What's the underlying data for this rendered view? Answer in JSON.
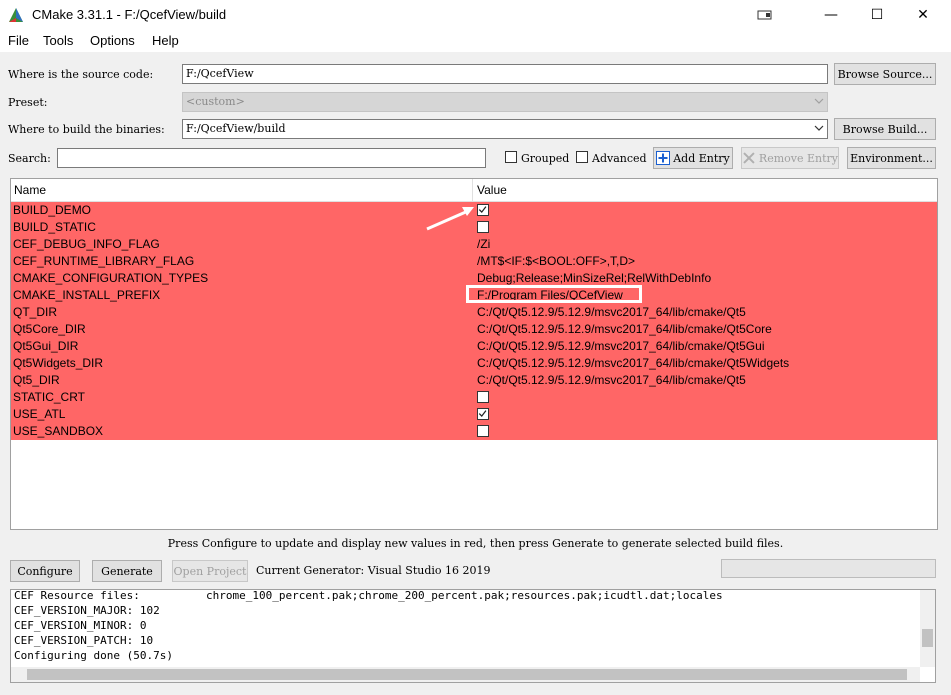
{
  "window": {
    "title": "CMake 3.31.1 - F:/QcefView/build",
    "minimize_glyph": "—",
    "maximize_glyph": "☐",
    "close_glyph": "✕"
  },
  "menu": [
    "File",
    "Tools",
    "Options",
    "Help"
  ],
  "source": {
    "label": "Where is the source code:",
    "value": "F:/QcefView",
    "browse_label": "Browse Source..."
  },
  "preset": {
    "label": "Preset:",
    "value": "<custom>"
  },
  "build": {
    "label": "Where to build the binaries:",
    "value": "F:/QcefView/build",
    "browse_label": "Browse Build..."
  },
  "search": {
    "label": "Search:",
    "value": "",
    "grouped_label": "Grouped",
    "advanced_label": "Advanced",
    "add_entry_label": "Add Entry",
    "remove_entry_label": "Remove Entry",
    "environment_label": "Environment..."
  },
  "table": {
    "columns": [
      "Name",
      "Value"
    ],
    "rows": [
      {
        "name": "BUILD_DEMO",
        "type": "bool",
        "checked": true,
        "value": ""
      },
      {
        "name": "BUILD_STATIC",
        "type": "bool",
        "checked": false,
        "value": ""
      },
      {
        "name": "CEF_DEBUG_INFO_FLAG",
        "type": "text",
        "value": "/Zi"
      },
      {
        "name": "CEF_RUNTIME_LIBRARY_FLAG",
        "type": "text",
        "value": "/MT$<IF:$<BOOL:OFF>,T,D>"
      },
      {
        "name": "CMAKE_CONFIGURATION_TYPES",
        "type": "text",
        "value": "Debug;Release;MinSizeRel;RelWithDebInfo"
      },
      {
        "name": "CMAKE_INSTALL_PREFIX",
        "type": "text",
        "value": "F:/Program Files/QCefView"
      },
      {
        "name": "QT_DIR",
        "type": "text",
        "value": "C:/Qt/Qt5.12.9/5.12.9/msvc2017_64/lib/cmake/Qt5"
      },
      {
        "name": "Qt5Core_DIR",
        "type": "text",
        "value": "C:/Qt/Qt5.12.9/5.12.9/msvc2017_64/lib/cmake/Qt5Core"
      },
      {
        "name": "Qt5Gui_DIR",
        "type": "text",
        "value": "C:/Qt/Qt5.12.9/5.12.9/msvc2017_64/lib/cmake/Qt5Gui"
      },
      {
        "name": "Qt5Widgets_DIR",
        "type": "text",
        "value": "C:/Qt/Qt5.12.9/5.12.9/msvc2017_64/lib/cmake/Qt5Widgets"
      },
      {
        "name": "Qt5_DIR",
        "type": "text",
        "value": "C:/Qt/Qt5.12.9/5.12.9/msvc2017_64/lib/cmake/Qt5"
      },
      {
        "name": "STATIC_CRT",
        "type": "bool",
        "checked": false,
        "value": ""
      },
      {
        "name": "USE_ATL",
        "type": "bool",
        "checked": true,
        "value": ""
      },
      {
        "name": "USE_SANDBOX",
        "type": "bool",
        "checked": false,
        "value": ""
      }
    ]
  },
  "status_message": "Press Configure to update and display new values in red, then press Generate to generate selected build files.",
  "actions": {
    "configure_label": "Configure",
    "generate_label": "Generate",
    "open_project_label": "Open Project",
    "current_generator": "Current Generator: Visual Studio 16 2019"
  },
  "log": [
    "CEF Resource files:          chrome_100_percent.pak;chrome_200_percent.pak;resources.pak;icudtl.dat;locales",
    "CEF_VERSION_MAJOR: 102",
    "CEF_VERSION_MINOR: 0",
    "CEF_VERSION_PATCH: 10",
    "Configuring done (50.7s)"
  ],
  "colors": {
    "changed_row": "#ff6666",
    "highlight_box": "#ffffff",
    "annotation_arrow": "#ffffff",
    "add_icon": "#1a5fd0"
  }
}
